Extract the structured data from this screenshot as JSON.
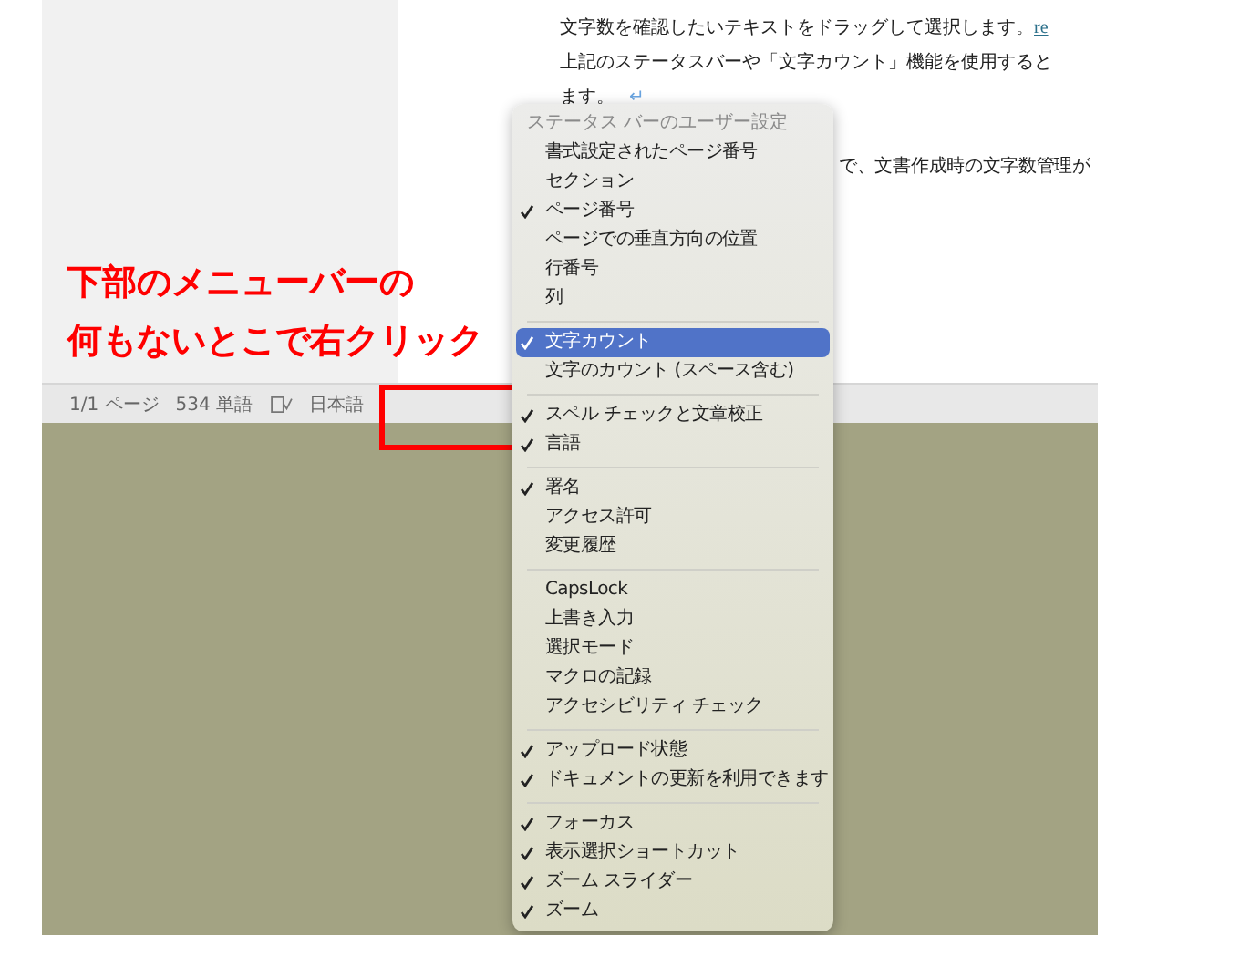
{
  "document": {
    "lines": [
      {
        "kind": "full",
        "text": "文字数を確認したいテキストをドラッグして選択します。",
        "link": "re"
      },
      {
        "kind": "full",
        "text": "上記のステータスバーや「文字カウント」機能を使用すると"
      },
      {
        "kind": "full",
        "text": "ます。",
        "mark": "↵"
      },
      {
        "kind": "blank"
      },
      {
        "kind": "partial",
        "text": "で、文書作成時の文字数管理が"
      }
    ]
  },
  "status_bar": {
    "page": "1/1 ページ",
    "words": "534 単語",
    "language": "日本語"
  },
  "annotation": {
    "lines": [
      "下部のメニューバーの",
      "何もないとこで右クリック"
    ]
  },
  "context_menu": {
    "title": "ステータス バーのユーザー設定",
    "groups": [
      [
        {
          "label": "書式設定されたページ番号",
          "checked": false,
          "selected": false
        },
        {
          "label": "セクション",
          "checked": false,
          "selected": false
        },
        {
          "label": "ページ番号",
          "checked": true,
          "selected": false
        },
        {
          "label": "ページでの垂直方向の位置",
          "checked": false,
          "selected": false
        },
        {
          "label": "行番号",
          "checked": false,
          "selected": false
        },
        {
          "label": "列",
          "checked": false,
          "selected": false
        }
      ],
      [
        {
          "label": "文字カウント",
          "checked": true,
          "selected": true
        },
        {
          "label": "文字のカウント (スペース含む)",
          "checked": false,
          "selected": false
        }
      ],
      [
        {
          "label": "スペル チェックと文章校正",
          "checked": true,
          "selected": false
        },
        {
          "label": "言語",
          "checked": true,
          "selected": false
        }
      ],
      [
        {
          "label": "署名",
          "checked": true,
          "selected": false
        },
        {
          "label": "アクセス許可",
          "checked": false,
          "selected": false
        },
        {
          "label": "変更履歴",
          "checked": false,
          "selected": false
        }
      ],
      [
        {
          "label": "CapsLock",
          "checked": false,
          "selected": false
        },
        {
          "label": "上書き入力",
          "checked": false,
          "selected": false
        },
        {
          "label": "選択モード",
          "checked": false,
          "selected": false
        },
        {
          "label": "マクロの記録",
          "checked": false,
          "selected": false
        },
        {
          "label": "アクセシビリティ チェック",
          "checked": false,
          "selected": false
        }
      ],
      [
        {
          "label": "アップロード状態",
          "checked": true,
          "selected": false
        },
        {
          "label": "ドキュメントの更新を利用できます",
          "checked": true,
          "selected": false
        }
      ],
      [
        {
          "label": "フォーカス",
          "checked": true,
          "selected": false
        },
        {
          "label": "表示選択ショートカット",
          "checked": true,
          "selected": false
        },
        {
          "label": "ズーム スライダー",
          "checked": true,
          "selected": false
        },
        {
          "label": "ズーム",
          "checked": true,
          "selected": false
        }
      ]
    ]
  }
}
